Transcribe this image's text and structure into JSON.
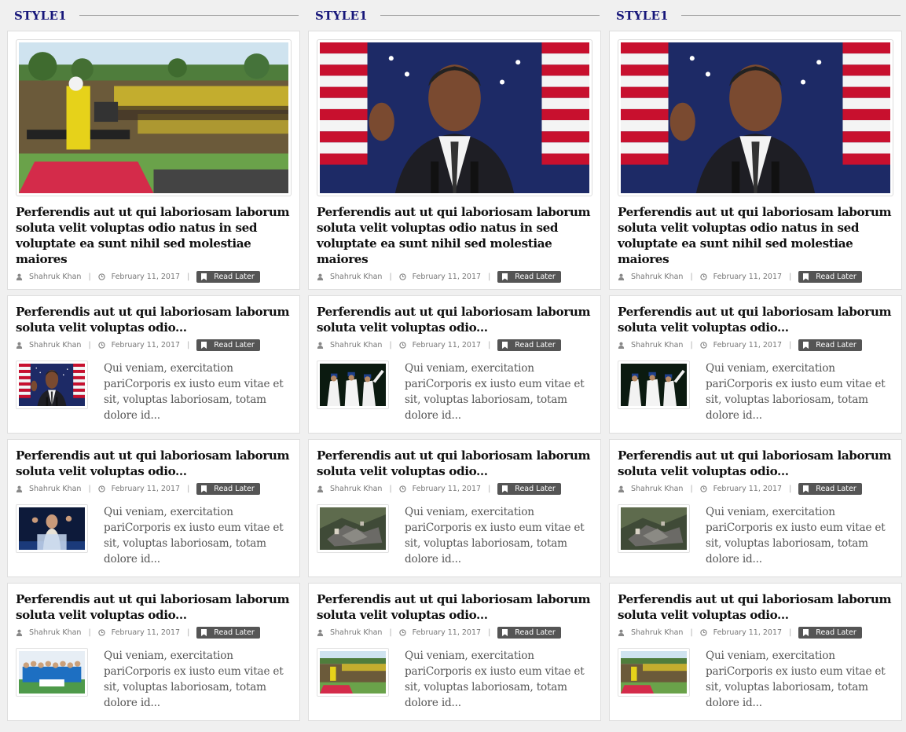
{
  "columns": [
    {
      "title": "STYLE1",
      "featured": {
        "image": "rally-photo",
        "title": "Perferendis aut ut qui laboriosam laborum soluta velit voluptas odio natus in sed voluptate ea sunt nihil sed molestiae maiores",
        "author": "Shahruk Khan",
        "date": "February 11, 2017",
        "read_later": "Read Later"
      },
      "items": [
        {
          "image": "obama-photo",
          "title": "Perferendis aut ut qui laboriosam laborum soluta velit voluptas odio...",
          "author": "Shahruk Khan",
          "date": "February 11, 2017",
          "read_later": "Read Later",
          "excerpt": "Qui veniam, exercitation pariCorporis ex iusto eum vitae et sit, voluptas laboriosam, totam dolore id..."
        },
        {
          "image": "speaker-photo",
          "title": "Perferendis aut ut qui laboriosam laborum soluta velit voluptas odio...",
          "author": "Shahruk Khan",
          "date": "February 11, 2017",
          "read_later": "Read Later",
          "excerpt": "Qui veniam, exercitation pariCorporis ex iusto eum vitae et sit, voluptas laboriosam, totam dolore id..."
        },
        {
          "image": "team-photo",
          "title": "Perferendis aut ut qui laboriosam laborum soluta velit voluptas odio...",
          "author": "Shahruk Khan",
          "date": "February 11, 2017",
          "read_later": "Read Later",
          "excerpt": "Qui veniam, exercitation pariCorporis ex iusto eum vitae et sit, voluptas laboriosam, totam dolore id..."
        }
      ]
    },
    {
      "title": "STYLE1",
      "featured": {
        "image": "obama-photo",
        "title": "Perferendis aut ut qui laboriosam laborum soluta velit voluptas odio natus in sed voluptate ea sunt nihil sed molestiae maiores",
        "author": "Shahruk Khan",
        "date": "February 11, 2017",
        "read_later": "Read Later"
      },
      "items": [
        {
          "image": "cricket-photo",
          "title": "Perferendis aut ut qui laboriosam laborum soluta velit voluptas odio...",
          "author": "Shahruk Khan",
          "date": "February 11, 2017",
          "read_later": "Read Later",
          "excerpt": "Qui veniam, exercitation pariCorporis ex iusto eum vitae et sit, voluptas laboriosam, totam dolore id..."
        },
        {
          "image": "wreckage-photo",
          "title": "Perferendis aut ut qui laboriosam laborum soluta velit voluptas odio...",
          "author": "Shahruk Khan",
          "date": "February 11, 2017",
          "read_later": "Read Later",
          "excerpt": "Qui veniam, exercitation pariCorporis ex iusto eum vitae et sit, voluptas laboriosam, totam dolore id..."
        },
        {
          "image": "rally-photo",
          "title": "Perferendis aut ut qui laboriosam laborum soluta velit voluptas odio...",
          "author": "Shahruk Khan",
          "date": "February 11, 2017",
          "read_later": "Read Later",
          "excerpt": "Qui veniam, exercitation pariCorporis ex iusto eum vitae et sit, voluptas laboriosam, totam dolore id..."
        }
      ]
    },
    {
      "title": "STYLE1",
      "featured": {
        "image": "obama-photo",
        "title": "Perferendis aut ut qui laboriosam laborum soluta velit voluptas odio natus in sed voluptate ea sunt nihil sed molestiae maiores",
        "author": "Shahruk Khan",
        "date": "February 11, 2017",
        "read_later": "Read Later"
      },
      "items": [
        {
          "image": "cricket-photo",
          "title": "Perferendis aut ut qui laboriosam laborum soluta velit voluptas odio...",
          "author": "Shahruk Khan",
          "date": "February 11, 2017",
          "read_later": "Read Later",
          "excerpt": "Qui veniam, exercitation pariCorporis ex iusto eum vitae et sit, voluptas laboriosam, totam dolore id..."
        },
        {
          "image": "wreckage-photo",
          "title": "Perferendis aut ut qui laboriosam laborum soluta velit voluptas odio...",
          "author": "Shahruk Khan",
          "date": "February 11, 2017",
          "read_later": "Read Later",
          "excerpt": "Qui veniam, exercitation pariCorporis ex iusto eum vitae et sit, voluptas laboriosam, totam dolore id..."
        },
        {
          "image": "rally-photo",
          "title": "Perferendis aut ut qui laboriosam laborum soluta velit voluptas odio...",
          "author": "Shahruk Khan",
          "date": "February 11, 2017",
          "read_later": "Read Later",
          "excerpt": "Qui veniam, exercitation pariCorporis ex iusto eum vitae et sit, voluptas laboriosam, totam dolore id..."
        }
      ]
    }
  ],
  "colors": {
    "heading": "#17177a",
    "badge": "#555555",
    "page_bg": "#f0f0f0"
  }
}
